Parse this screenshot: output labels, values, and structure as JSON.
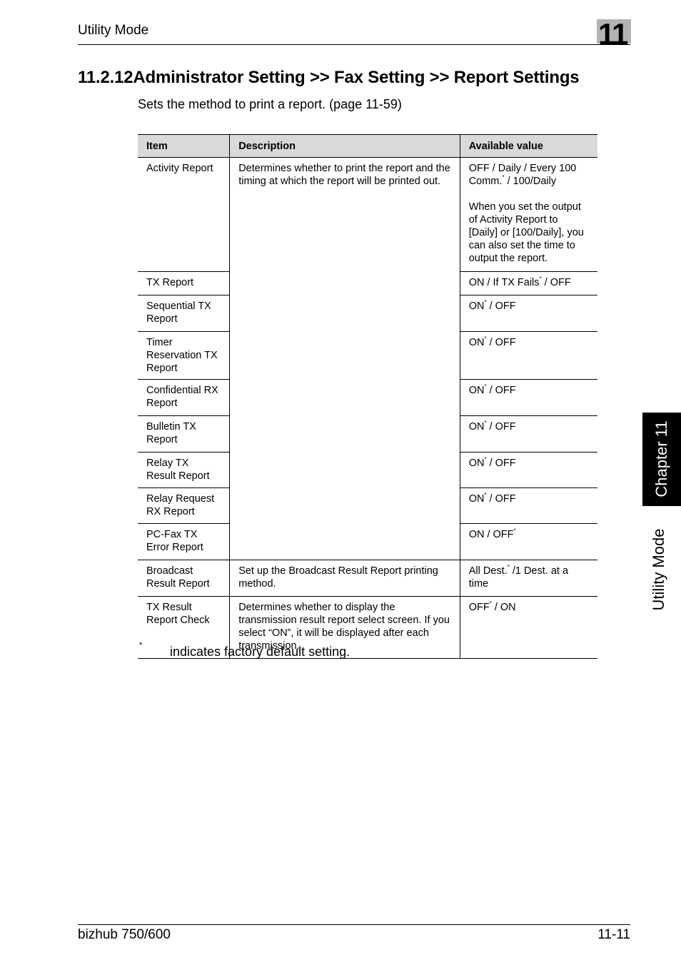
{
  "header": {
    "title": "Utility Mode",
    "chapter_number": "11"
  },
  "section": {
    "title": "11.2.12Administrator Setting >> Fax Setting >> Report Settings",
    "intro": "Sets the method to print a report. (page 11-59)"
  },
  "table": {
    "columns": [
      "Item",
      "Description",
      "Available value"
    ],
    "rows": [
      {
        "item": "Activity Report",
        "value_pre": "OFF / Daily / Every 100 Comm.",
        "value_mark": "*",
        "value_post": " / 100/Daily",
        "note": "When you set the output of Activity Report to [Daily] or [100/Daily], you can also set the time to output the report."
      },
      {
        "item": "TX Report",
        "value_pre": "ON / If TX Fails",
        "value_mark": "*",
        "value_post": " / OFF"
      },
      {
        "item": "Sequential TX Report",
        "value_pre": "ON",
        "value_mark": "*",
        "value_post": " / OFF"
      },
      {
        "item": "Timer Reservation TX Report",
        "value_pre": "ON",
        "value_mark": "*",
        "value_post": " / OFF"
      },
      {
        "item": "Confidential RX Report",
        "value_pre": "ON",
        "value_mark": "*",
        "value_post": " / OFF"
      },
      {
        "item": "Bulletin TX Report",
        "value_pre": "ON",
        "value_mark": "*",
        "value_post": " / OFF"
      },
      {
        "item": "Relay TX Result Report",
        "value_pre": "ON",
        "value_mark": "*",
        "value_post": " / OFF"
      },
      {
        "item": "Relay Request RX Report",
        "value_pre": "ON",
        "value_mark": "*",
        "value_post": " / OFF"
      },
      {
        "item": "PC-Fax TX Error Report",
        "value_pre": "ON / OFF",
        "value_mark": "*",
        "value_post": ""
      },
      {
        "item": "Broadcast Result Report",
        "description": "Set up the Broadcast Result Report printing method.",
        "value_pre": "All Dest.",
        "value_mark": "*",
        "value_post": " /1 Dest. at a time"
      },
      {
        "item": "TX Result Report Check",
        "description": "Determines whether to display the transmission result report select screen. If you select “ON”, it will be displayed after each transmission.",
        "value_pre": "OFF",
        "value_mark": "*",
        "value_post": " / ON"
      }
    ],
    "shared_description": "Determines whether to print the report and the timing at which the report will be printed out."
  },
  "footnote": {
    "mark": "*",
    "text": "indicates factory default setting."
  },
  "side_tab": {
    "chapter": "Chapter 11",
    "section": "Utility Mode"
  },
  "footer": {
    "product": "bizhub 750/600",
    "page": "11-11"
  }
}
